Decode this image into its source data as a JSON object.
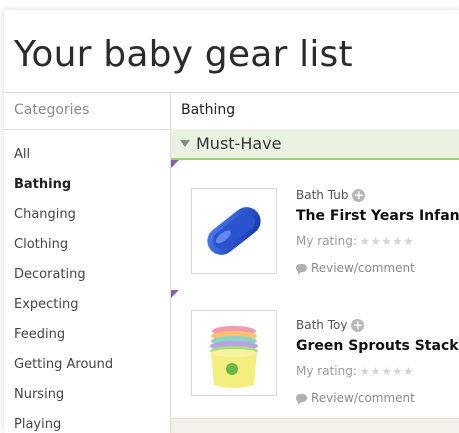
{
  "page": {
    "title": "Your baby gear list"
  },
  "sidebar": {
    "heading": "Categories",
    "items": [
      {
        "label": "All"
      },
      {
        "label": "Bathing"
      },
      {
        "label": "Changing"
      },
      {
        "label": "Clothing"
      },
      {
        "label": "Decorating"
      },
      {
        "label": "Expecting"
      },
      {
        "label": "Feeding"
      },
      {
        "label": "Getting Around"
      },
      {
        "label": "Nursing"
      },
      {
        "label": "Playing"
      }
    ],
    "active": "Bathing"
  },
  "main": {
    "section_title": "Bathing",
    "group": {
      "label": "Must-Have"
    },
    "items": [
      {
        "category": "Bath Tub",
        "title": "The First Years Infant",
        "rating_label": "My rating:",
        "stars": "★★★★★",
        "review_label": "Review/comment",
        "icon": "blue-bath-tub"
      },
      {
        "category": "Bath Toy",
        "title": "Green Sprouts Stackir",
        "rating_label": "My rating:",
        "stars": "★★★★★",
        "review_label": "Review/comment",
        "icon": "stacking-cups"
      }
    ]
  },
  "colors": {
    "accent_green": "#9ccf6f",
    "group_bg": "#eaf3e2",
    "corner_purple": "#8b5fa8"
  }
}
